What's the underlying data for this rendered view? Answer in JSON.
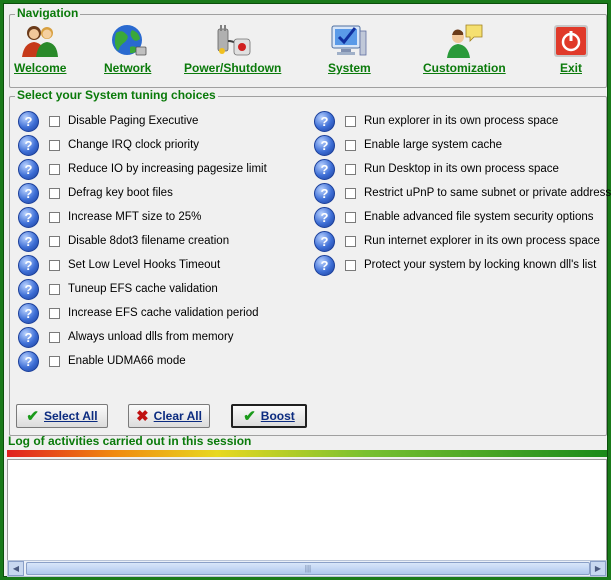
{
  "nav": {
    "legend": "Navigation",
    "items": [
      {
        "id": "welcome",
        "label": "Welcome",
        "icon": "users-icon"
      },
      {
        "id": "network",
        "label": "Network",
        "icon": "globe-icon"
      },
      {
        "id": "power",
        "label": "Power/Shutdown",
        "icon": "power-plug-icon"
      },
      {
        "id": "system",
        "label": "System",
        "icon": "monitor-check-icon"
      },
      {
        "id": "customization",
        "label": "Customization",
        "icon": "user-chat-icon"
      },
      {
        "id": "exit",
        "label": "Exit",
        "icon": "exit-power-icon"
      }
    ]
  },
  "tuning": {
    "legend": "Select your System tuning choices",
    "left": [
      "Disable Paging Executive",
      "Change IRQ clock priority",
      "Reduce IO by increasing pagesize limit",
      "Defrag key boot files",
      "Increase MFT size to 25%",
      "Disable 8dot3 filename creation",
      "Set Low Level Hooks Timeout",
      "Tuneup EFS cache validation",
      "Increase EFS cache validation period",
      "Always unload dlls from memory",
      "Enable UDMA66 mode"
    ],
    "right": [
      "Run explorer in its own process space",
      "Enable large system cache",
      "Run Desktop in its own process space",
      "Restrict uPnP  to same subnet or private address",
      "Enable advanced file system security options",
      "Run internet explorer in its own process space",
      "Protect your system by locking known dll's list"
    ],
    "help_glyph": "?",
    "buttons": {
      "select_all": "Select All",
      "clear_all": "Clear All",
      "boost": "Boost"
    }
  },
  "log": {
    "title": "Log of activities carried out in this session"
  },
  "colors": {
    "accent_green": "#0a7a0a",
    "window_border": "#1a7a1a",
    "button_text": "#0b2b80"
  }
}
